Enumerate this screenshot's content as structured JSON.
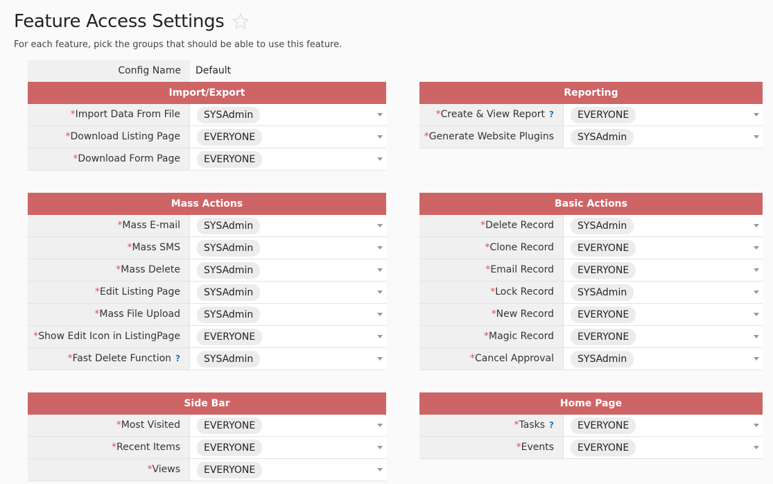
{
  "page": {
    "title": "Feature Access Settings",
    "subtitle": "For each feature, pick the groups that should be able to use this feature."
  },
  "config": {
    "label": "Config Name",
    "value": "Default"
  },
  "colors": {
    "section_header": "#cd6566",
    "required_star": "#d9534f",
    "help_icon": "#1a73c8"
  },
  "sections": {
    "import_export": {
      "title": "Import/Export",
      "rows": [
        {
          "label": "Import Data From File",
          "value": "SYSAdmin"
        },
        {
          "label": "Download Listing Page",
          "value": "EVERYONE"
        },
        {
          "label": "Download Form Page",
          "value": "EVERYONE"
        }
      ]
    },
    "reporting": {
      "title": "Reporting",
      "rows": [
        {
          "label": "Create & View Report",
          "value": "EVERYONE",
          "help": "?"
        },
        {
          "label": "Generate Website Plugins",
          "value": "SYSAdmin"
        }
      ]
    },
    "mass_actions": {
      "title": "Mass Actions",
      "rows": [
        {
          "label": "Mass E-mail",
          "value": "SYSAdmin"
        },
        {
          "label": "Mass SMS",
          "value": "SYSAdmin"
        },
        {
          "label": "Mass Delete",
          "value": "SYSAdmin"
        },
        {
          "label": "Edit Listing Page",
          "value": "SYSAdmin"
        },
        {
          "label": "Mass File Upload",
          "value": "SYSAdmin"
        },
        {
          "label": "Show Edit Icon in ListingPage",
          "value": "EVERYONE"
        },
        {
          "label": "Fast Delete Function",
          "value": "SYSAdmin",
          "help": "?"
        }
      ]
    },
    "basic_actions": {
      "title": "Basic Actions",
      "rows": [
        {
          "label": "Delete Record",
          "value": "SYSAdmin"
        },
        {
          "label": "Clone Record",
          "value": "EVERYONE"
        },
        {
          "label": "Email Record",
          "value": "EVERYONE"
        },
        {
          "label": "Lock Record",
          "value": "SYSAdmin"
        },
        {
          "label": "New Record",
          "value": "EVERYONE"
        },
        {
          "label": "Magic Record",
          "value": "EVERYONE"
        },
        {
          "label": "Cancel Approval",
          "value": "SYSAdmin"
        }
      ]
    },
    "side_bar": {
      "title": "Side Bar",
      "rows": [
        {
          "label": "Most Visited",
          "value": "EVERYONE"
        },
        {
          "label": "Recent Items",
          "value": "EVERYONE"
        },
        {
          "label": "Views",
          "value": "EVERYONE"
        }
      ]
    },
    "home_page": {
      "title": "Home Page",
      "rows": [
        {
          "label": "Tasks",
          "value": "EVERYONE",
          "help": "?"
        },
        {
          "label": "Events",
          "value": "EVERYONE"
        }
      ]
    }
  }
}
